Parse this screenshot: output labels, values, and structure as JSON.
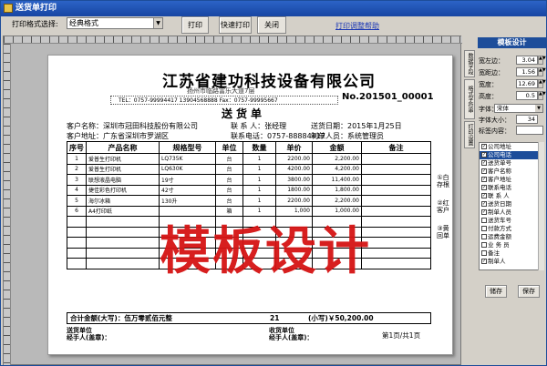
{
  "window": {
    "title": "送货单打印"
  },
  "toolbar": {
    "format_label": "打印格式选择:",
    "format_value": "经典格式",
    "print_button": "打印",
    "quick_print_button": "快速打印",
    "close_button": "关闭",
    "help_link": "打印调整帮助"
  },
  "doc": {
    "company": "江苏省建功科技设备有限公司",
    "address": "扬州市临路富乐大道7层",
    "contact": "TEL：0757-99994417  13904568888  Fax：0757-99995667",
    "doc_no": "No.201501_00001",
    "doc_title": "送货单",
    "customer_name_label": "客户名称：",
    "customer_name": "深圳市冠田科技股份有限公司",
    "contact_person_label": "联 系 人：",
    "contact_person": "张经理",
    "date_label": "送货日期：",
    "date": "2015年1月25日",
    "customer_addr_label": "客户地址：",
    "customer_addr": "广东省深圳市罗湖区",
    "phone_label": "联系电话：",
    "phone": "0757-88884417",
    "maker_label": "制单人员：",
    "maker": "系统管理员",
    "headers": [
      "序号",
      "产品名称",
      "规格型号",
      "单位",
      "数量",
      "单价",
      "金额",
      "备注"
    ],
    "rows": [
      [
        "1",
        "爱普生打印机",
        "LQ735K",
        "台",
        "1",
        "2200.00",
        "2,200.00",
        ""
      ],
      [
        "2",
        "爱普生打印机",
        "LQ630K",
        "台",
        "1",
        "4200.00",
        "4,200.00",
        ""
      ],
      [
        "3",
        "联想液晶电脑",
        "19寸",
        "台",
        "1",
        "3800.00",
        "11,400.00",
        ""
      ],
      [
        "4",
        "捷佳彩色打印机",
        "42寸",
        "台",
        "1",
        "1800.00",
        "1,800.00",
        ""
      ],
      [
        "5",
        "海尔冰箱",
        "130升",
        "台",
        "1",
        "2200.00",
        "2,200.00",
        ""
      ],
      [
        "6",
        "A4打印纸",
        "",
        "箱",
        "1",
        "1,000",
        "1,000.00",
        ""
      ]
    ],
    "total_label": "合计金额(大写)：伍万零贰佰元整",
    "total_qty": "21",
    "total_small": "(小写)￥50,200.00",
    "sender_unit": "送货单位",
    "sender_sign": "经手人(盖章)：",
    "receiver_unit": "收货单位",
    "receiver_sign": "经手人(盖章)：",
    "page": "第1页/共1页",
    "copy_labels": [
      "①白存根",
      "②红客户",
      "③黄回单"
    ]
  },
  "watermark": "模板设计",
  "panel": {
    "title": "模板设计",
    "vtabs": [
      "数据字段",
      "格式字符串",
      "打印设置"
    ],
    "fields": [
      {
        "label": "宽左边：",
        "value": "3.04"
      },
      {
        "label": "宽距边：",
        "value": "1.56"
      },
      {
        "label": "宽度：",
        "value": "12.69"
      },
      {
        "label": "高度：",
        "value": "0.5"
      }
    ],
    "font_label": "字体：",
    "font_value": "宋体",
    "fontsize_label": "字体大小：",
    "fontsize_value": "34",
    "param_label": "标签内容：",
    "list": [
      {
        "label": "公司地址",
        "checked": true
      },
      {
        "label": "公司电话",
        "checked": true,
        "selected": true
      },
      {
        "label": "送货单号",
        "checked": true
      },
      {
        "label": "客户名称",
        "checked": true
      },
      {
        "label": "客户地址",
        "checked": true
      },
      {
        "label": "联系电话",
        "checked": true
      },
      {
        "label": "联 系 人",
        "checked": true
      },
      {
        "label": "送货日期",
        "checked": true
      },
      {
        "label": "制单人员",
        "checked": true
      },
      {
        "label": "送货车号",
        "checked": false
      },
      {
        "label": "付款方式",
        "checked": false
      },
      {
        "label": "运费金额",
        "checked": false
      },
      {
        "label": "业 务 员",
        "checked": false
      },
      {
        "label": "备注",
        "checked": false
      },
      {
        "label": "制单人",
        "checked": true
      }
    ],
    "save_template_button": "储存",
    "save_button": "保存"
  }
}
